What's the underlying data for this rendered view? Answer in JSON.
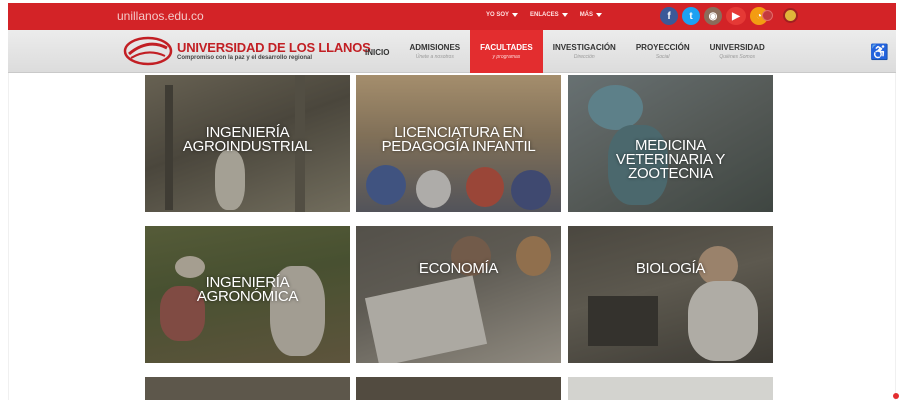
{
  "topbar": {
    "domain": "unillanos.edu.co",
    "menu": [
      {
        "label": "YO SOY"
      },
      {
        "label": "ENLACES"
      },
      {
        "label": "MÁS"
      }
    ],
    "socials": [
      {
        "icon": "facebook-icon",
        "glyph": "f"
      },
      {
        "icon": "twitter-icon",
        "glyph": "t"
      },
      {
        "icon": "instagram-icon",
        "glyph": "◉"
      },
      {
        "icon": "youtube-icon",
        "glyph": "▶"
      },
      {
        "icon": "rss-icon",
        "glyph": "◔"
      }
    ]
  },
  "header": {
    "logo_title": "UNIVERSIDAD DE LOS LLANOS",
    "logo_subtitle": "Compromiso con la paz y el desarrollo regional",
    "nav": [
      {
        "label": "INICIO",
        "sub": ""
      },
      {
        "label": "ADMISIONES",
        "sub": "Únete a nosotros"
      },
      {
        "label": "FACULTADES",
        "sub": "y programas"
      },
      {
        "label": "INVESTIGACIÓN",
        "sub": "Dirección"
      },
      {
        "label": "PROYECCIÓN",
        "sub": "Social"
      },
      {
        "label": "UNIVERSIDAD",
        "sub": "Quiénes Somos"
      }
    ],
    "accessibility_glyph": "♿"
  },
  "tiles": [
    {
      "label": "Ingeniería\nAgroindustrial"
    },
    {
      "label": "Licenciatura en\nPedagogía Infantil"
    },
    {
      "label": "Medicina\nVeterinaria y\nZootecnia"
    },
    {
      "label": "Ingeniería\nAgronómica"
    },
    {
      "label": "Economía"
    },
    {
      "label": "Biología"
    }
  ],
  "colors": {
    "brand_red": "#d32327",
    "active_nav": "#e32d2f"
  }
}
